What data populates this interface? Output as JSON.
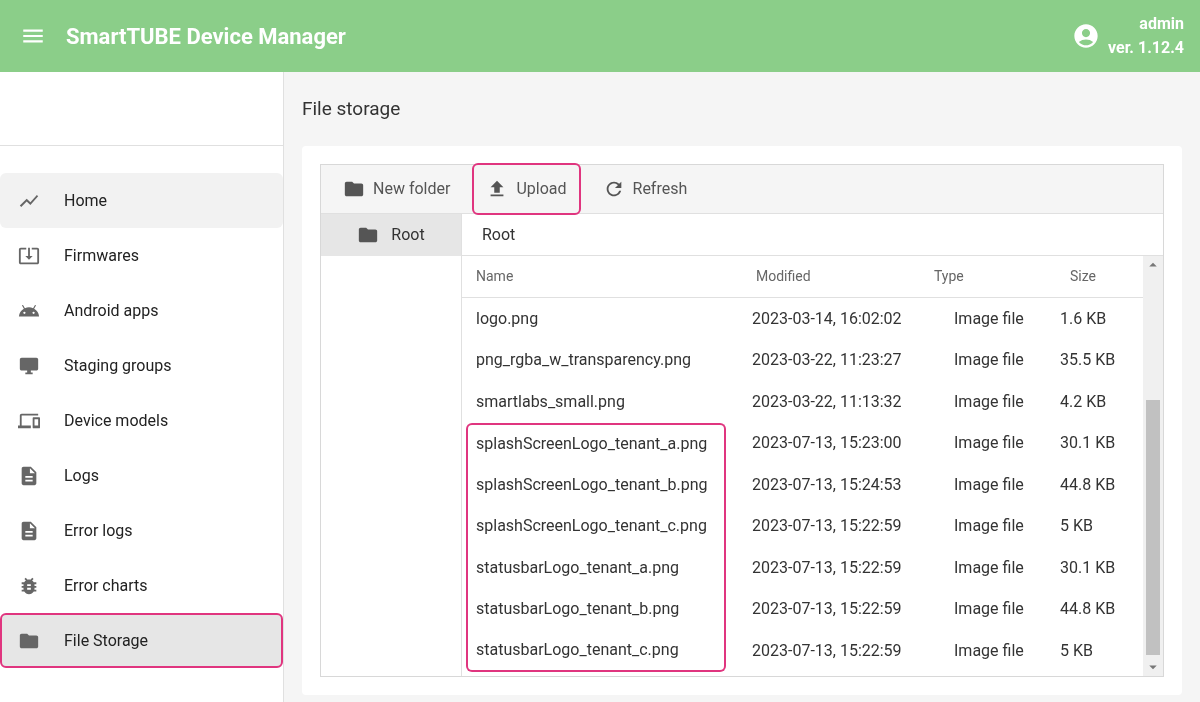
{
  "app_bar": {
    "title": "SmartTUBE Device Manager",
    "user": "admin",
    "version": "ver. 1.12.4"
  },
  "sidebar": {
    "items": [
      {
        "label": "Home",
        "selected": false,
        "hovered": true,
        "highlighted": false
      },
      {
        "label": "Firmwares",
        "selected": false,
        "hovered": false,
        "highlighted": false
      },
      {
        "label": "Android apps",
        "selected": false,
        "hovered": false,
        "highlighted": false
      },
      {
        "label": "Staging groups",
        "selected": false,
        "hovered": false,
        "highlighted": false
      },
      {
        "label": "Device models",
        "selected": false,
        "hovered": false,
        "highlighted": false
      },
      {
        "label": "Logs",
        "selected": false,
        "hovered": false,
        "highlighted": false
      },
      {
        "label": "Error logs",
        "selected": false,
        "hovered": false,
        "highlighted": false
      },
      {
        "label": "Error charts",
        "selected": false,
        "hovered": false,
        "highlighted": false
      },
      {
        "label": "File Storage",
        "selected": true,
        "hovered": false,
        "highlighted": true
      }
    ]
  },
  "page_title": "File storage",
  "toolbar": [
    {
      "label": "New folder",
      "highlighted": false
    },
    {
      "label": "Upload",
      "highlighted": true
    },
    {
      "label": "Refresh",
      "highlighted": false
    }
  ],
  "tree": [
    {
      "label": "Root",
      "selected": true
    }
  ],
  "breadcrumb": "Root",
  "table": {
    "columns": [
      "Name",
      "Modified",
      "Type",
      "Size"
    ],
    "rows": [
      {
        "name": "logo.png",
        "modified": "2023-03-14, 16:02:02",
        "type": "Image file",
        "size": "1.6 KB",
        "highlighted": false
      },
      {
        "name": "png_rgba_w_transparency.png",
        "modified": "2023-03-22, 11:23:27",
        "type": "Image file",
        "size": "35.5 KB",
        "highlighted": false
      },
      {
        "name": "smartlabs_small.png",
        "modified": "2023-03-22, 11:13:32",
        "type": "Image file",
        "size": "4.2 KB",
        "highlighted": false
      },
      {
        "name": "splashScreenLogo_tenant_a.png",
        "modified": "2023-07-13, 15:23:00",
        "type": "Image file",
        "size": "30.1 KB",
        "highlighted": true
      },
      {
        "name": "splashScreenLogo_tenant_b.png",
        "modified": "2023-07-13, 15:24:53",
        "type": "Image file",
        "size": "44.8 KB",
        "highlighted": true
      },
      {
        "name": "splashScreenLogo_tenant_c.png",
        "modified": "2023-07-13, 15:22:59",
        "type": "Image file",
        "size": "5 KB",
        "highlighted": true
      },
      {
        "name": "statusbarLogo_tenant_a.png",
        "modified": "2023-07-13, 15:22:59",
        "type": "Image file",
        "size": "30.1 KB",
        "highlighted": true
      },
      {
        "name": "statusbarLogo_tenant_b.png",
        "modified": "2023-07-13, 15:22:59",
        "type": "Image file",
        "size": "44.8 KB",
        "highlighted": true
      },
      {
        "name": "statusbarLogo_tenant_c.png",
        "modified": "2023-07-13, 15:22:59",
        "type": "Image file",
        "size": "5 KB",
        "highlighted": true
      }
    ]
  }
}
